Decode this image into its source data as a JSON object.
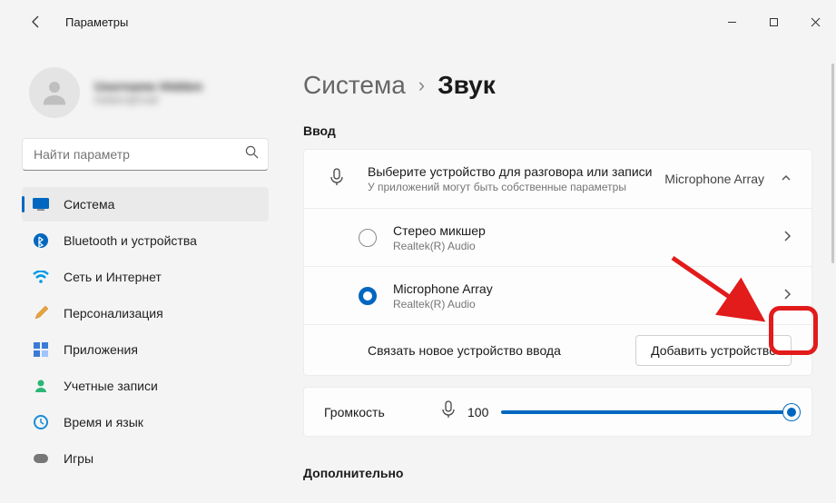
{
  "app": {
    "title": "Параметры"
  },
  "profile": {
    "name": "Username Hidden",
    "email": "hidden@mail"
  },
  "search": {
    "placeholder": "Найти параметр"
  },
  "nav": [
    {
      "label": "Система",
      "selected": true
    },
    {
      "label": "Bluetooth и устройства"
    },
    {
      "label": "Сеть и Интернет"
    },
    {
      "label": "Персонализация"
    },
    {
      "label": "Приложения"
    },
    {
      "label": "Учетные записи"
    },
    {
      "label": "Время и язык"
    },
    {
      "label": "Игры"
    }
  ],
  "breadcrumb": {
    "parent": "Система",
    "current": "Звук"
  },
  "section_input": "Ввод",
  "input_device": {
    "title": "Выберите устройство для разговора или записи",
    "subtitle": "У приложений могут быть собственные параметры",
    "value": "Microphone Array"
  },
  "devices": [
    {
      "name": "Стерео микшер",
      "driver": "Realtek(R) Audio",
      "selected": false
    },
    {
      "name": "Microphone Array",
      "driver": "Realtek(R) Audio",
      "selected": true
    }
  ],
  "pair": {
    "label": "Связать новое устройство ввода",
    "button": "Добавить устройство"
  },
  "volume": {
    "label": "Громкость",
    "value": "100"
  },
  "section_more": "Дополнительно"
}
